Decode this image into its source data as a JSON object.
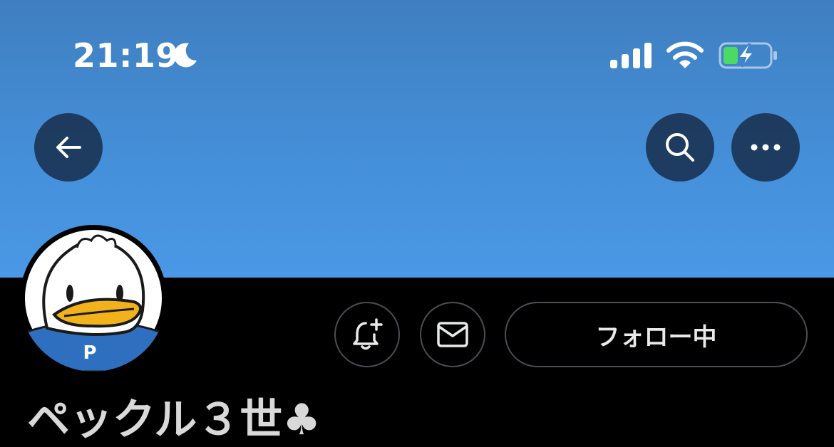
{
  "status_bar": {
    "time": "21:19",
    "focus_icon": "moon-icon",
    "signal_icon": "cellular-signal-icon",
    "wifi_icon": "wifi-icon",
    "battery_icon": "battery-charging-icon",
    "battery_color": "#4cd964"
  },
  "header": {
    "back_icon": "arrow-left-icon",
    "search_icon": "search-icon",
    "more_icon": "more-horizontal-icon",
    "banner_color": "#4590da"
  },
  "profile": {
    "avatar": "duck-character-avatar",
    "avatar_shirt_letter": "P",
    "display_name": "ペックル３世♣"
  },
  "actions": {
    "notify_icon": "bell-plus-icon",
    "message_icon": "envelope-icon",
    "follow_label": "フォロー中"
  }
}
